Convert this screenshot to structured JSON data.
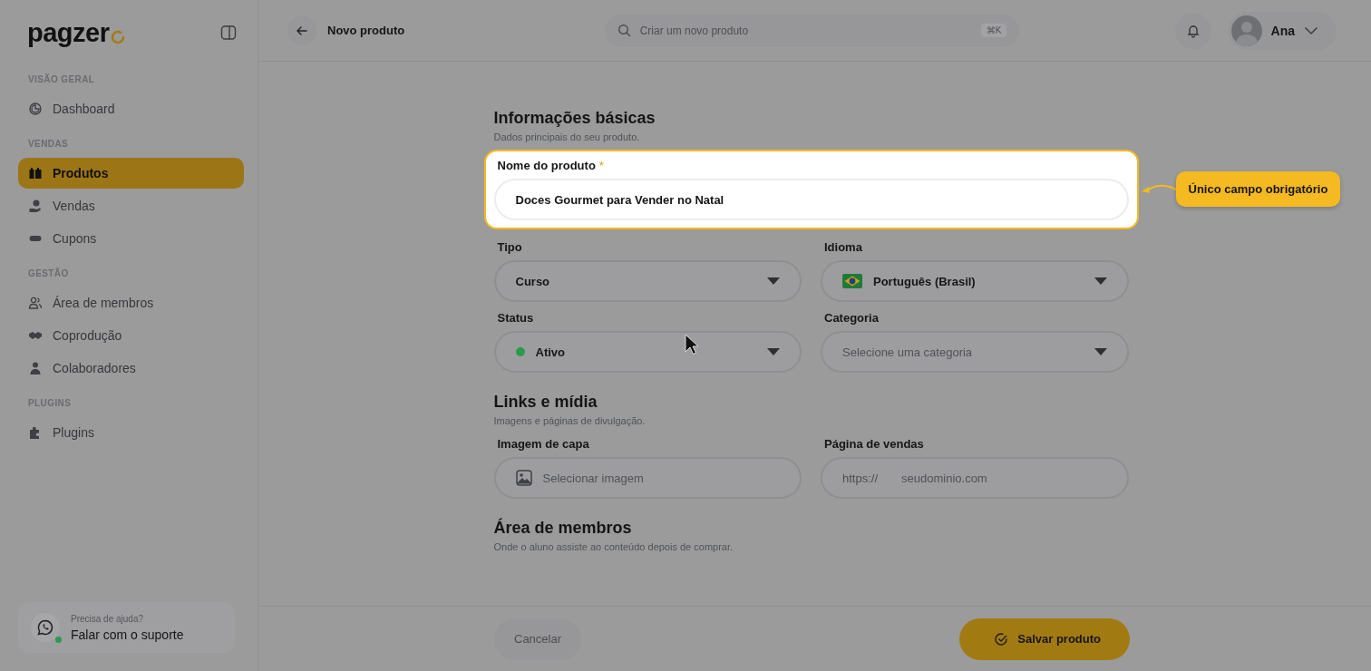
{
  "sidebar": {
    "logo": "pagzer",
    "sections": [
      {
        "heading": "VISÃO GERAL",
        "items": [
          {
            "label": "Dashboard",
            "selected": false
          }
        ]
      },
      {
        "heading": "VENDAS",
        "items": [
          {
            "label": "Produtos",
            "selected": true
          },
          {
            "label": "Vendas",
            "selected": false
          },
          {
            "label": "Cupons",
            "selected": false
          }
        ]
      },
      {
        "heading": "GESTÃO",
        "items": [
          {
            "label": "Área de membros",
            "selected": false
          },
          {
            "label": "Coprodução",
            "selected": false
          },
          {
            "label": "Colaboradores",
            "selected": false
          }
        ]
      },
      {
        "heading": "PLUGINS",
        "items": [
          {
            "label": "Plugins",
            "selected": false
          }
        ]
      }
    ],
    "support": {
      "hint": "Precisa de ajuda?",
      "label": "Falar com o suporte",
      "online": true
    }
  },
  "topbar": {
    "title": "Novo produto",
    "search": {
      "placeholder": "Criar um novo produto",
      "shortcut": "⌘K"
    },
    "user": "Ana"
  },
  "sections": [
    {
      "title": "Informações básicas",
      "subtitle": "Dados principais do seu produto.",
      "highlighted": {
        "label": "Nome do produto",
        "required_mark": "*",
        "value": "Doces Gourmet para Vender no Natal",
        "callout": "Único campo obrigatório"
      },
      "fields": [
        {
          "kind": "select",
          "label": "Tipo",
          "value": "Curso"
        },
        {
          "kind": "flag-select",
          "label": "Idioma",
          "value": "Português (Brasil)"
        },
        {
          "kind": "status-select",
          "label": "Status",
          "value": "Ativo",
          "color": "#2a9a4c"
        },
        {
          "kind": "select",
          "label": "Categoria",
          "placeholder": "Selecione uma categoria"
        }
      ]
    },
    {
      "title": "Links e mídia",
      "subtitle": "Imagens e páginas de divulgação.",
      "fields": [
        {
          "kind": "image-picker",
          "label": "Imagem de capa",
          "placeholder": "Selecionar imagem"
        },
        {
          "kind": "url",
          "label": "Página de vendas",
          "prefix": "https://",
          "placeholder": "seudominio.com"
        }
      ]
    },
    {
      "title": "Área de membros",
      "subtitle": "Onde o aluno assiste ao conteúdo depois de comprar."
    }
  ],
  "footer": {
    "cancel": "Cancelar",
    "save": "Salvar produto"
  }
}
